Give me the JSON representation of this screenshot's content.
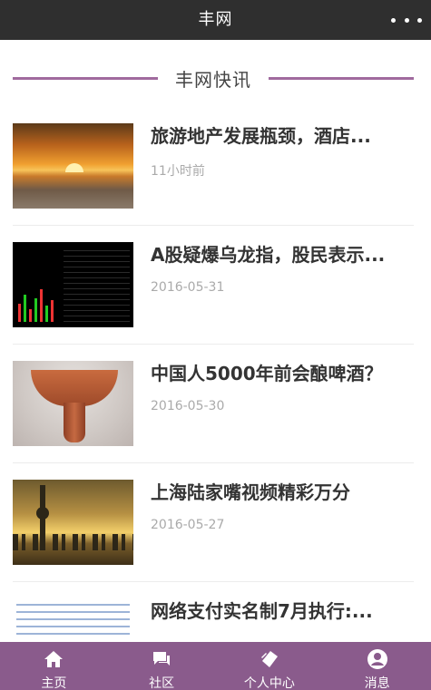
{
  "header": {
    "title": "丰网"
  },
  "section": {
    "title": "丰网快讯"
  },
  "news": [
    {
      "title": "旅游地产发展瓶颈，酒店...",
      "time": "11小时前",
      "thumb": "sunset-beach"
    },
    {
      "title": "A股疑爆乌龙指，股民表示...",
      "time": "2016-05-31",
      "thumb": "stock-chart"
    },
    {
      "title": "中国人5000年前会酿啤酒？",
      "time": "2016-05-30",
      "thumb": "ancient-cup"
    },
    {
      "title": "上海陆家嘴视频精彩万分",
      "time": "2016-05-27",
      "thumb": "city-skyline"
    },
    {
      "title": "网络支付实名制7月执行:...",
      "time": "",
      "thumb": "text-document"
    }
  ],
  "tabs": [
    {
      "label": "主页",
      "icon": "home-icon"
    },
    {
      "label": "社区",
      "icon": "chat-icon"
    },
    {
      "label": "个人中心",
      "icon": "tag-icon"
    },
    {
      "label": "消息",
      "icon": "user-circle-icon"
    }
  ],
  "colors": {
    "topbar": "#2f2f2f",
    "accent": "#8a5b8c",
    "divider": "#a06a9e"
  }
}
